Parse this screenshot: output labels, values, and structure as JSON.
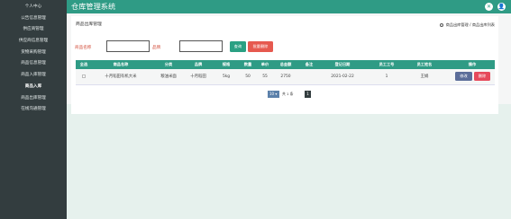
{
  "app": {
    "title": "仓库管理系统",
    "accent": "#2f9b85"
  },
  "topbar": {
    "icons": [
      "close-icon",
      "user-icon"
    ]
  },
  "sidebar": {
    "items": [
      {
        "label": "个人中心"
      },
      {
        "label": "公告信息管理"
      },
      {
        "label": "供应商管理"
      },
      {
        "label": "供应商信息管理"
      },
      {
        "label": "货物采购管理"
      },
      {
        "label": "商品信息管理"
      },
      {
        "label": "商品入库管理"
      },
      {
        "label": "商品入库",
        "active": true
      },
      {
        "label": "商品出库管理"
      },
      {
        "label": "在线沟通管理"
      }
    ]
  },
  "page": {
    "title": "商品出库管理",
    "breadcrumb": [
      "商品出库管理",
      "商品出库列表"
    ]
  },
  "search": {
    "name_label": "商品名称",
    "brand_label": "品牌",
    "name_value": "",
    "brand_value": "",
    "search_button": "查询",
    "batch_delete_button": "批量删除"
  },
  "table": {
    "headers": [
      "全选",
      "商品名称",
      "分类",
      "品牌",
      "规格",
      "数量",
      "单价",
      "总金额",
      "备注",
      "登记日期",
      "员工工号",
      "员工姓名",
      "操作"
    ],
    "rows": [
      {
        "name": "十月稻田有机大米",
        "category": "粮油米面",
        "brand": "十月稻田",
        "spec": "5kg",
        "qty": "50",
        "price": "55",
        "total": "2750",
        "note": "",
        "date": "2021-02-22",
        "emp_id": "1",
        "emp_name": "王娟",
        "edit": "修改",
        "delete": "删除"
      }
    ]
  },
  "pager": {
    "page_size": "10",
    "total_text": "共 1 条",
    "current_page": "1"
  }
}
